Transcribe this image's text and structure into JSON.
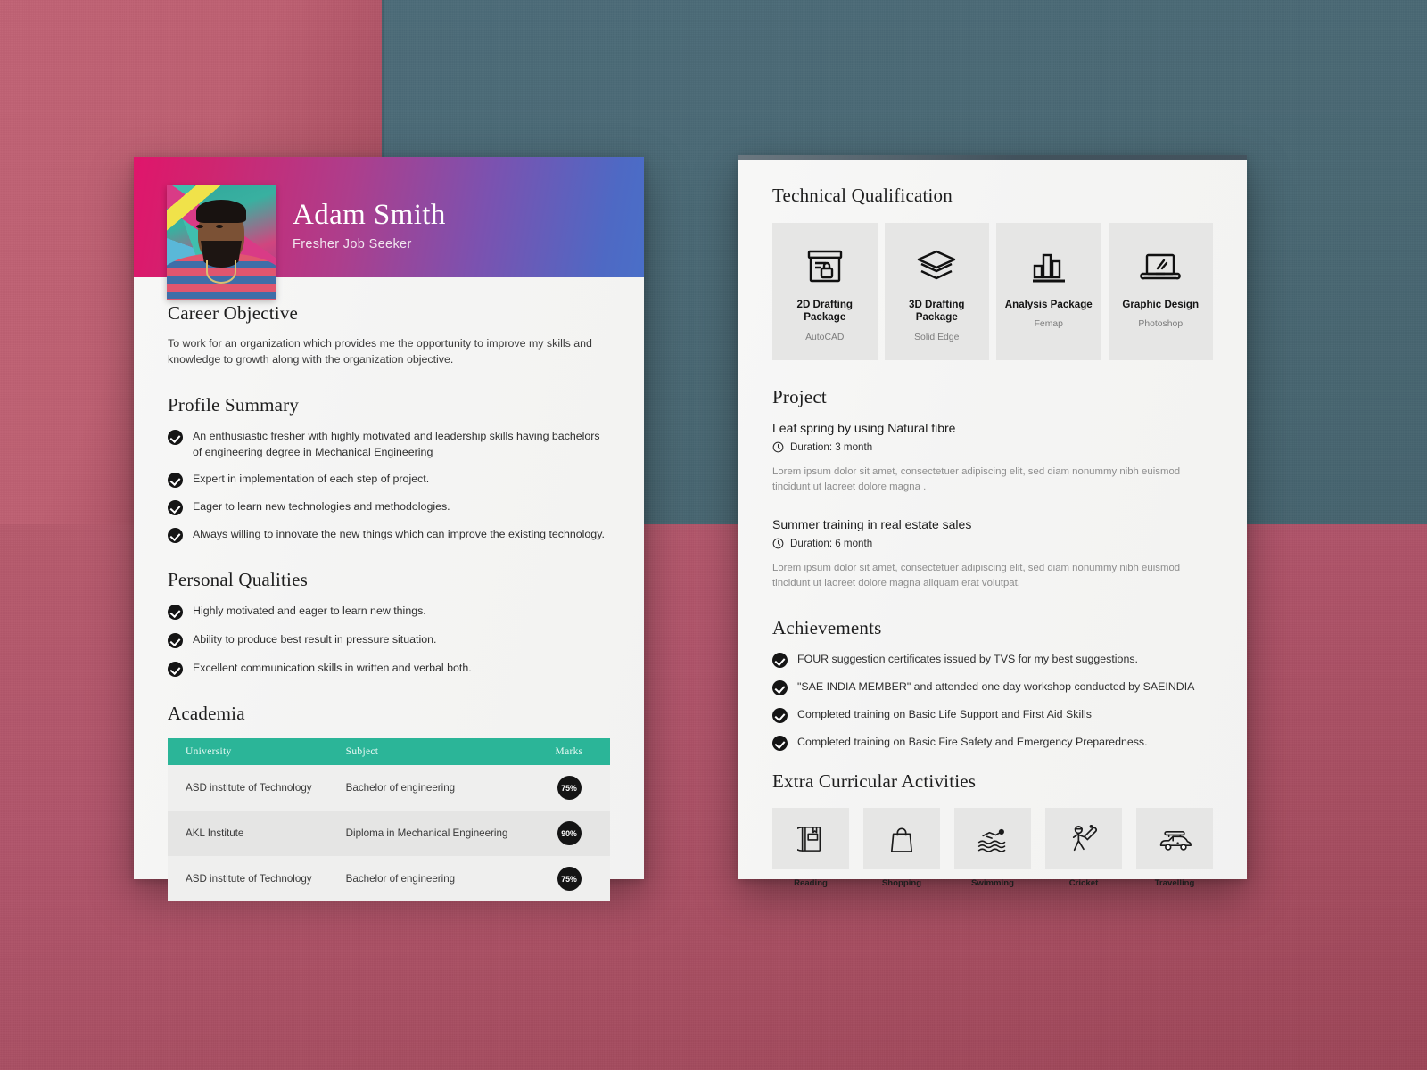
{
  "document": {
    "kind": "resume-template-mockup",
    "page_count": 2
  },
  "colors": {
    "banner_start": "#e0156b",
    "banner_mid": "#7b52b0",
    "banner_end": "#4a6fc8",
    "table_header": "#2bb598",
    "badge": "#141414",
    "bg_rose": "#b8596b",
    "bg_teal": "#4c6b78",
    "paper": "#f4f4f3",
    "card": "#e6e6e5"
  },
  "page1": {
    "header": {
      "name": "Adam Smith",
      "subtitle": "Fresher Job Seeker",
      "photo_alt": "profile-photo"
    },
    "career_objective": {
      "title": "Career Objective",
      "text": "To work for an organization which provides me the opportunity to improve my skills and knowledge to growth along with the organization objective."
    },
    "profile_summary": {
      "title": "Profile Summary",
      "items": [
        "An enthusiastic fresher with highly motivated and leadership skills having bachelors of engineering degree in Mechanical Engineering",
        "Expert in implementation of each step of project.",
        "Eager to learn new technologies and methodologies.",
        "Always willing to innovate the new things which can improve the existing technology."
      ]
    },
    "personal_qualities": {
      "title": "Personal Qualities",
      "items": [
        "Highly motivated and eager to learn new things.",
        "Ability to produce best result in pressure situation.",
        "Excellent communication skills in written and verbal both."
      ]
    },
    "academia": {
      "title": "Academia",
      "columns": [
        "University",
        "Subject",
        "Marks"
      ],
      "rows": [
        {
          "university": "ASD institute of Technology",
          "subject": "Bachelor of engineering",
          "marks": "75%"
        },
        {
          "university": "AKL Institute",
          "subject": "Diploma in Mechanical Engineering",
          "marks": "90%"
        },
        {
          "university": "ASD institute of Technology",
          "subject": "Bachelor of engineering",
          "marks": "75%"
        }
      ]
    }
  },
  "page2": {
    "technical_qualification": {
      "title": "Technical Qualification",
      "cards": [
        {
          "name": "2D Drafting Package",
          "tool": "AutoCAD",
          "icon": "drafting-board-lock-icon"
        },
        {
          "name": "3D Drafting Package",
          "tool": "Solid Edge",
          "icon": "layers-stack-icon"
        },
        {
          "name": "Analysis Package",
          "tool": "Femap",
          "icon": "bar-chart-icon"
        },
        {
          "name": "Graphic Design",
          "tool": "Photoshop",
          "icon": "laptop-icon"
        }
      ]
    },
    "project": {
      "title": "Project",
      "items": [
        {
          "name": "Leaf spring by using Natural fibre",
          "duration": "Duration: 3 month",
          "description": "Lorem ipsum dolor sit amet, consectetuer adipiscing elit, sed diam nonummy nibh euismod tincidunt ut laoreet dolore magna ."
        },
        {
          "name": "Summer training in real estate sales",
          "duration": "Duration: 6 month",
          "description": "Lorem ipsum dolor sit amet, consectetuer adipiscing elit, sed diam nonummy nibh euismod tincidunt ut laoreet dolore magna aliquam erat volutpat."
        }
      ]
    },
    "achievements": {
      "title": "Achievements",
      "items": [
        "FOUR suggestion certificates issued by TVS for my best suggestions.",
        "\"SAE INDIA MEMBER\" and attended one day workshop conducted by SAEINDIA",
        "Completed training on Basic Life Support and First Aid Skills",
        "Completed training on Basic Fire Safety and Emergency Preparedness."
      ]
    },
    "extra_curricular": {
      "title": "Extra Curricular Activities",
      "items": [
        {
          "label": "Reading",
          "icon": "book-icon"
        },
        {
          "label": "Shopping",
          "icon": "shopping-bag-icon"
        },
        {
          "label": "Swimming",
          "icon": "swimmer-icon"
        },
        {
          "label": "Cricket",
          "icon": "cricket-batsman-icon"
        },
        {
          "label": "Travelling",
          "icon": "car-with-luggage-icon"
        }
      ]
    }
  }
}
